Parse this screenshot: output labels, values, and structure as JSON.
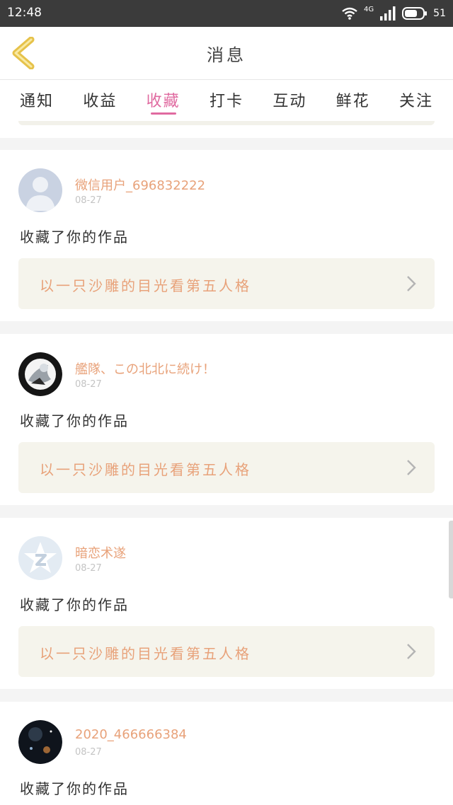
{
  "status": {
    "time": "12:48",
    "network": "4G",
    "battery": "51"
  },
  "header": {
    "title": "消息"
  },
  "tabs": [
    {
      "label": "通知"
    },
    {
      "label": "收益"
    },
    {
      "label": "收藏"
    },
    {
      "label": "打卡"
    },
    {
      "label": "互动"
    },
    {
      "label": "鲜花"
    },
    {
      "label": "关注"
    }
  ],
  "active_tab": "收藏",
  "messages": [
    {
      "user": "微信用户_696832222",
      "date": "08-27",
      "action": "收藏了你的作品",
      "work": "以一只沙雕的目光看第五人格"
    },
    {
      "user": "艦隊、この北北に続け！",
      "date": "08-27",
      "action": "收藏了你的作品",
      "work": "以一只沙雕的目光看第五人格"
    },
    {
      "user": "暗恋术遂",
      "date": "08-27",
      "action": "收藏了你的作品",
      "work": "以一只沙雕的目光看第五人格"
    },
    {
      "user": "2020_466666384",
      "date": "08-27",
      "action": "收藏了你的作品"
    }
  ],
  "colors": {
    "accent": "#e06aa0",
    "link": "#e8a27a",
    "card_bg": "#f5f4ec"
  }
}
